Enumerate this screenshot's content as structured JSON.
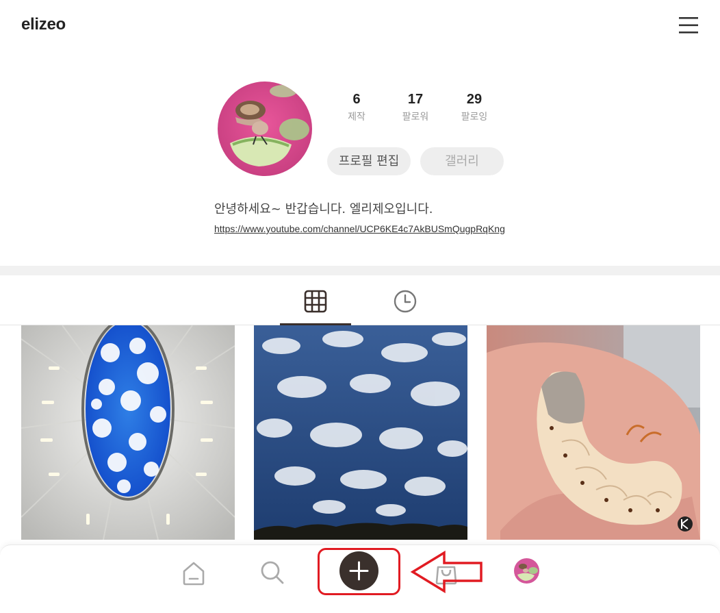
{
  "header": {
    "brand": "elizeo",
    "menu_icon": "hamburger-menu-icon"
  },
  "profile": {
    "avatar_alt": "profile avatar (snail on cucumber slice)",
    "stats": [
      {
        "value": "6",
        "label": "제작"
      },
      {
        "value": "17",
        "label": "팔로워"
      },
      {
        "value": "29",
        "label": "팔로잉"
      }
    ],
    "edit_button": "프로필 편집",
    "gallery_button": "갤러리",
    "bio": "안녕하세요~ 반갑습니다. 엘리제오입니다.",
    "link": "https://www.youtube.com/channel/UCP6KE4c7AkBUSmQugpRqKng"
  },
  "tabs": [
    {
      "name": "grid",
      "icon": "grid-icon",
      "active": true
    },
    {
      "name": "recent",
      "icon": "clock-icon",
      "active": false
    }
  ],
  "posts": [
    {
      "icon": "ceiling-sky-image"
    },
    {
      "icon": "cloudy-sky-image"
    },
    {
      "icon": "beetle-larva-image"
    }
  ],
  "bottom_nav": [
    {
      "name": "home",
      "icon": "home-icon"
    },
    {
      "name": "search",
      "icon": "search-icon"
    },
    {
      "name": "add",
      "icon": "plus-icon"
    },
    {
      "name": "shop",
      "icon": "shopping-bag-icon"
    },
    {
      "name": "profile",
      "icon": "avatar-icon"
    }
  ],
  "colors": {
    "accent": "#3a302c",
    "annotation": "#e11b22",
    "muted": "#999999",
    "pill_bg": "#eeeeee"
  }
}
